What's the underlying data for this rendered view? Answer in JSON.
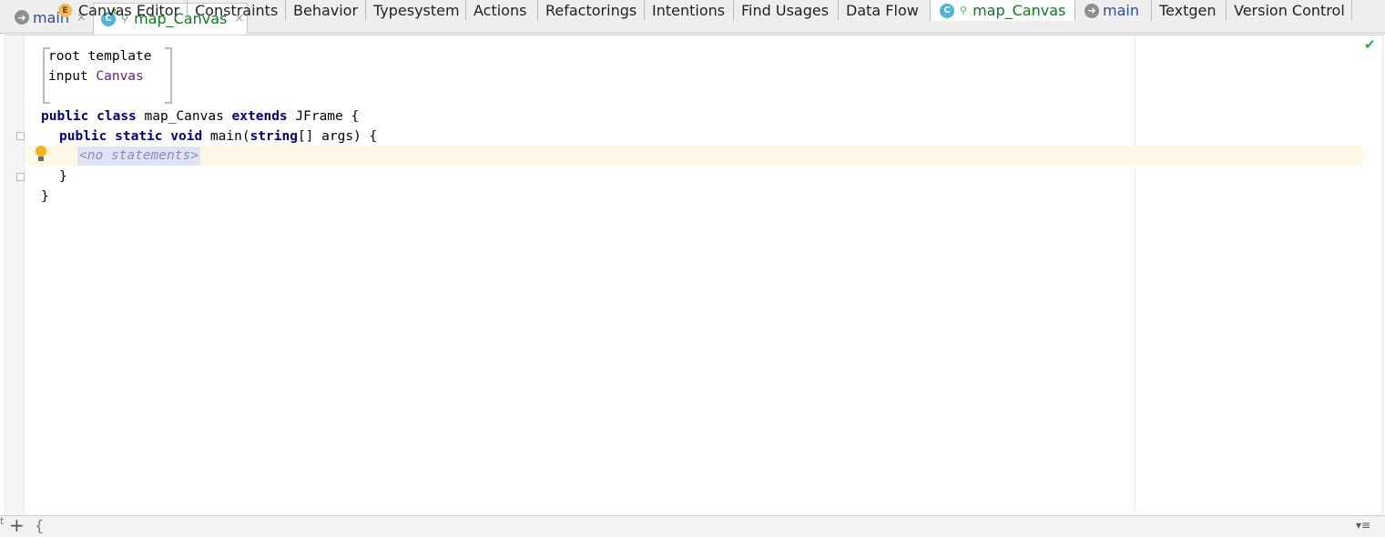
{
  "editor_tabs": [
    {
      "label": "main",
      "icon": "arrow-right-icon",
      "close": "×"
    },
    {
      "label": "map_Canvas",
      "icon": "class-c-icon",
      "close": "×",
      "active": true
    }
  ],
  "code": {
    "root_template_1": "root template",
    "root_template_2a": "input ",
    "root_template_2b": "Canvas",
    "class_line": {
      "kw1": "public",
      "kw2": "class",
      "name": " map_Canvas ",
      "kw3": "extends",
      "rest": " JFrame {"
    },
    "method_line": {
      "kw1": "public",
      "kw2": "static",
      "kw3": "void",
      "name": " main(",
      "kw4": "string",
      "rest": "[] args) {"
    },
    "no_statements": "<no statements>",
    "close_method": "}",
    "close_class": "}"
  },
  "status_check": "✔",
  "bottom_tabs": [
    {
      "label": "Canvas Editor",
      "icon": "e-icon"
    },
    {
      "label": "Constraints"
    },
    {
      "label": "Behavior"
    },
    {
      "label": "Typesystem"
    },
    {
      "label": "Actions"
    },
    {
      "label": "Refactorings"
    },
    {
      "label": "Intentions"
    },
    {
      "label": "Find Usages"
    },
    {
      "label": "Data Flow"
    },
    {
      "label": "map_Canvas",
      "icon": "class-c-icon",
      "active": true
    },
    {
      "label": "main",
      "icon": "arrow-right-icon"
    },
    {
      "label": "Textgen"
    },
    {
      "label": "Version Control"
    }
  ],
  "bottom_controls": {
    "plus": "+",
    "brace": "{",
    "more": "▾≡"
  },
  "colors": {
    "keyword": "#000080",
    "reference": "#6b1a85",
    "active_tab_text": "#0d7a1b",
    "caret_line": "#fdf9e6"
  }
}
